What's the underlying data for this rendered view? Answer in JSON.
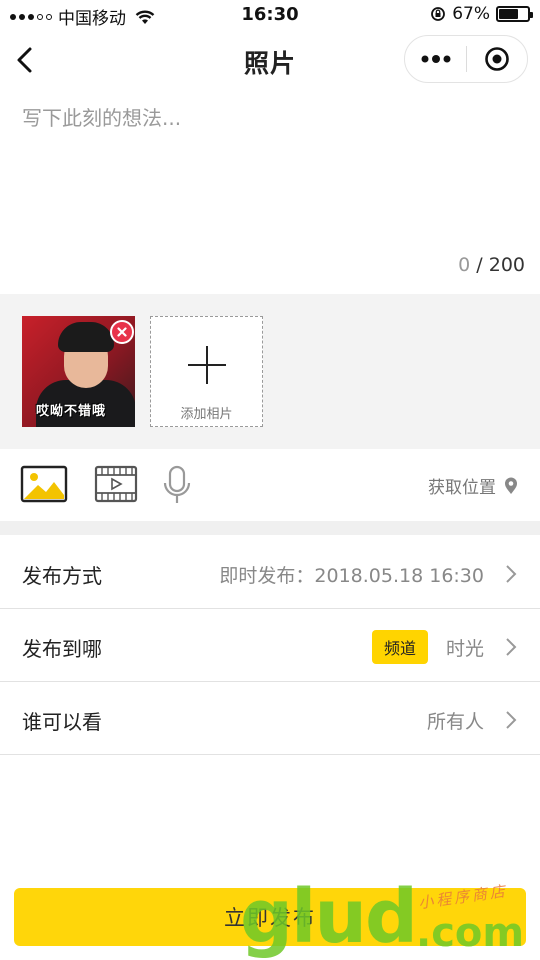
{
  "status_bar": {
    "carrier": "中国移动",
    "time": "16:30",
    "battery_text": "67%",
    "battery_level": 0.67
  },
  "nav": {
    "title": "照片",
    "back_icon": "chevron-left-icon",
    "more_icon": "more-dots-icon",
    "close_icon": "target-close-icon"
  },
  "editor": {
    "placeholder": "写下此刻的想法...",
    "value": "",
    "char_current": "0",
    "char_sep_max": " / 200"
  },
  "photos": {
    "items": [
      {
        "caption": "哎呦不错哦"
      }
    ],
    "add_label": "添加相片"
  },
  "tools": {
    "image_icon": "image-icon",
    "video_icon": "video-icon",
    "mic_icon": "microphone-icon",
    "location_label": "获取位置"
  },
  "settings": {
    "publish_mode": {
      "label": "发布方式",
      "value": "即时发布：2018.05.18 16:30"
    },
    "publish_to": {
      "label": "发布到哪",
      "tag": "频道",
      "value": "时光"
    },
    "visibility": {
      "label": "谁可以看",
      "value": "所有人"
    }
  },
  "publish_button": {
    "label": "立即发布"
  },
  "watermark": {
    "text": "glud",
    "sub": ".com",
    "script": "小程序商店"
  },
  "colors": {
    "accent": "#ffd60a",
    "remove_red": "#e8334a"
  }
}
